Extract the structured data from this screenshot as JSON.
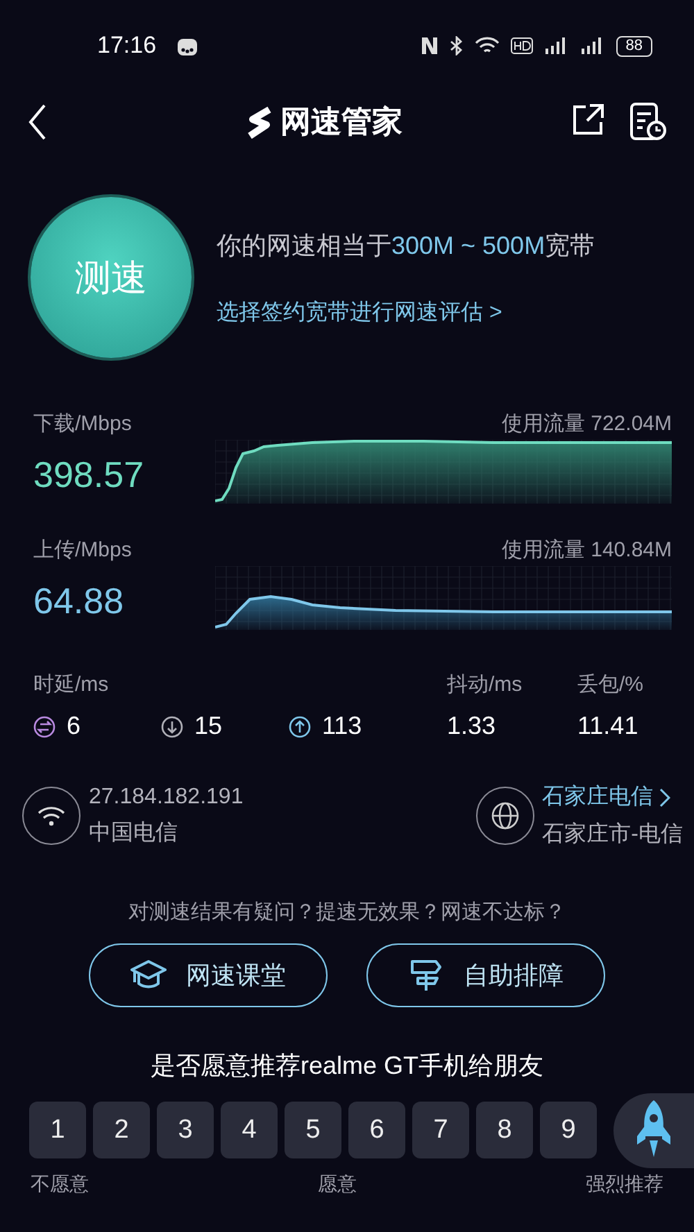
{
  "status_bar": {
    "time": "17:16",
    "battery": "88"
  },
  "header": {
    "title": "网速管家"
  },
  "summary": {
    "button": "测速",
    "headline_parts": [
      "你的网速相当于",
      "300M ~ 500M",
      "宽带"
    ],
    "link": "选择签约宽带进行网速评估 >"
  },
  "speeds": [
    {
      "kind": "download",
      "label": "下载/Mbps",
      "value": "398.57",
      "usage": "使用流量 722.04M"
    },
    {
      "kind": "upload",
      "label": "上传/Mbps",
      "value": "64.88",
      "usage": "使用流量 140.84M"
    }
  ],
  "latency": {
    "label": "时延/ms",
    "items": [
      {
        "kind": "idle",
        "value": "6"
      },
      {
        "kind": "down",
        "value": "15"
      },
      {
        "kind": "up",
        "value": "113"
      }
    ]
  },
  "jitter": {
    "label": "抖动/ms",
    "value": "1.33"
  },
  "loss": {
    "label": "丢包/%",
    "value": "11.41"
  },
  "network": {
    "ip": "27.184.182.191",
    "carrier": "中国电信"
  },
  "server": {
    "name": "石家庄电信",
    "location": "石家庄市-电信"
  },
  "help": {
    "question": "对测速结果有疑问？提速无效果？网速不达标？",
    "buttons": [
      {
        "kind": "course",
        "label": "网速课堂"
      },
      {
        "kind": "troubleshoot",
        "label": "自助排障"
      }
    ]
  },
  "survey": {
    "question": "是否愿意推荐realme GT手机给朋友",
    "scores": [
      "1",
      "2",
      "3",
      "4",
      "5",
      "6",
      "7",
      "8",
      "9"
    ],
    "labels": [
      "不愿意",
      "愿意",
      "强烈推荐"
    ]
  }
}
